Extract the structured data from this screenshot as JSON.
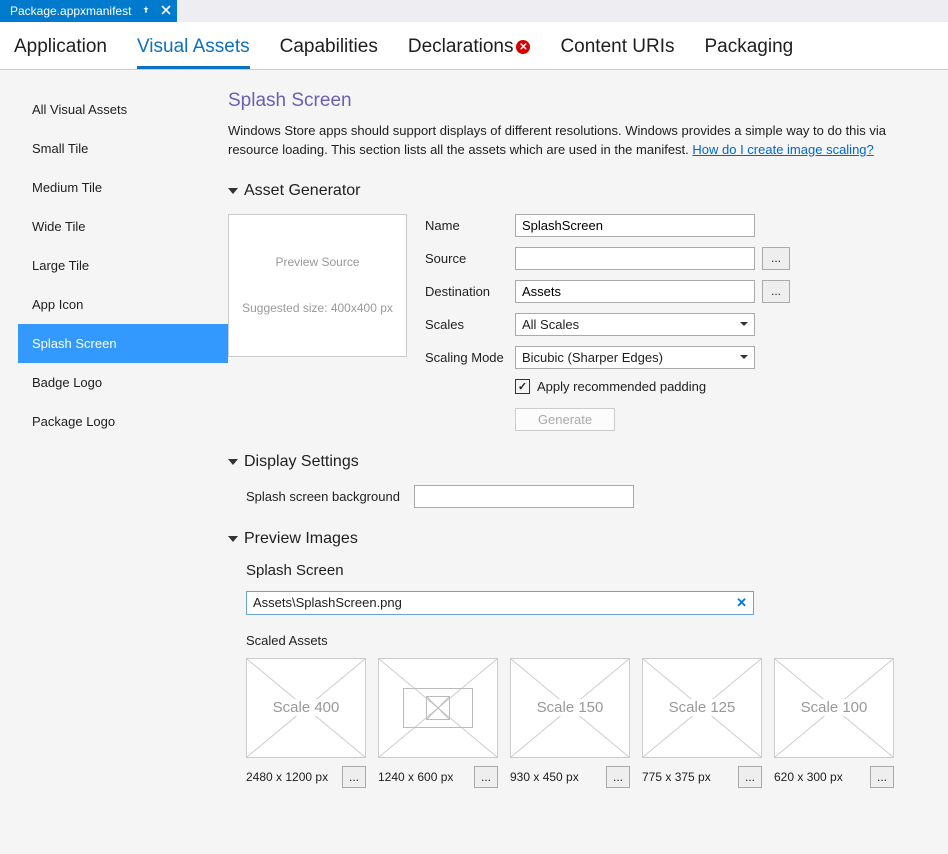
{
  "docTab": {
    "title": "Package.appxmanifest"
  },
  "mainTabs": [
    {
      "label": "Application",
      "active": false,
      "error": false
    },
    {
      "label": "Visual Assets",
      "active": true,
      "error": false
    },
    {
      "label": "Capabilities",
      "active": false,
      "error": false
    },
    {
      "label": "Declarations",
      "active": false,
      "error": true
    },
    {
      "label": "Content URIs",
      "active": false,
      "error": false
    },
    {
      "label": "Packaging",
      "active": false,
      "error": false
    }
  ],
  "sidebar": [
    "All Visual Assets",
    "Small Tile",
    "Medium Tile",
    "Wide Tile",
    "Large Tile",
    "App Icon",
    "Splash Screen",
    "Badge Logo",
    "Package Logo"
  ],
  "sidebarSelectedIndex": 6,
  "pageTitle": "Splash Screen",
  "description1": "Windows Store apps should support displays of different resolutions. Windows provides a simple way to do this via resource loading. This section lists all the assets which are used in the manifest. ",
  "descriptionLink": "How do I create image scaling?",
  "sectionAssetGen": "Asset Generator",
  "preview": {
    "line1": "Preview Source",
    "line2": "Suggested size: 400x400 px"
  },
  "form": {
    "nameLabel": "Name",
    "nameValue": "SplashScreen",
    "sourceLabel": "Source",
    "sourceValue": "",
    "destLabel": "Destination",
    "destValue": "Assets",
    "scalesLabel": "Scales",
    "scalesValue": "All Scales",
    "modeLabel": "Scaling Mode",
    "modeValue": "Bicubic (Sharper Edges)",
    "paddingLabel": "Apply recommended padding",
    "generateLabel": "Generate",
    "browseLabel": "..."
  },
  "sectionDisplay": "Display Settings",
  "displayForm": {
    "bgLabel": "Splash screen background",
    "bgValue": ""
  },
  "sectionPreview": "Preview Images",
  "previewSub": {
    "title": "Splash Screen",
    "pathValue": "Assets\\SplashScreen.png",
    "scaledLabel": "Scaled Assets"
  },
  "scaledAssets": [
    {
      "label": "Scale 400",
      "dim": "2480 x 1200 px",
      "hasImage": false
    },
    {
      "label": "",
      "dim": "1240 x 600 px",
      "hasImage": true
    },
    {
      "label": "Scale 150",
      "dim": "930 x 450 px",
      "hasImage": false
    },
    {
      "label": "Scale 125",
      "dim": "775 x 375 px",
      "hasImage": false
    },
    {
      "label": "Scale 100",
      "dim": "620 x 300 px",
      "hasImage": false
    }
  ],
  "ellipsis": "..."
}
